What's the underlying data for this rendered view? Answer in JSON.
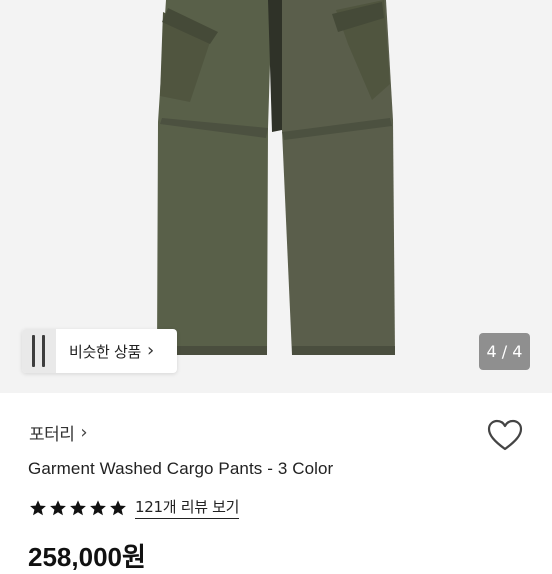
{
  "gallery": {
    "similar_label": "비슷한 상품",
    "counter": "4 / 4"
  },
  "product": {
    "brand": "포터리",
    "name": "Garment Washed Cargo Pants - 3 Color",
    "rating_stars": 5,
    "review_link": "121개 리뷰 보기",
    "price": "258,000원"
  },
  "colors": {
    "pants": "#5a5e4c",
    "hero_bg": "#f3f3f3",
    "star": "#111111"
  },
  "icons": [
    "chevron-right-icon",
    "heart-icon",
    "star-icon"
  ]
}
